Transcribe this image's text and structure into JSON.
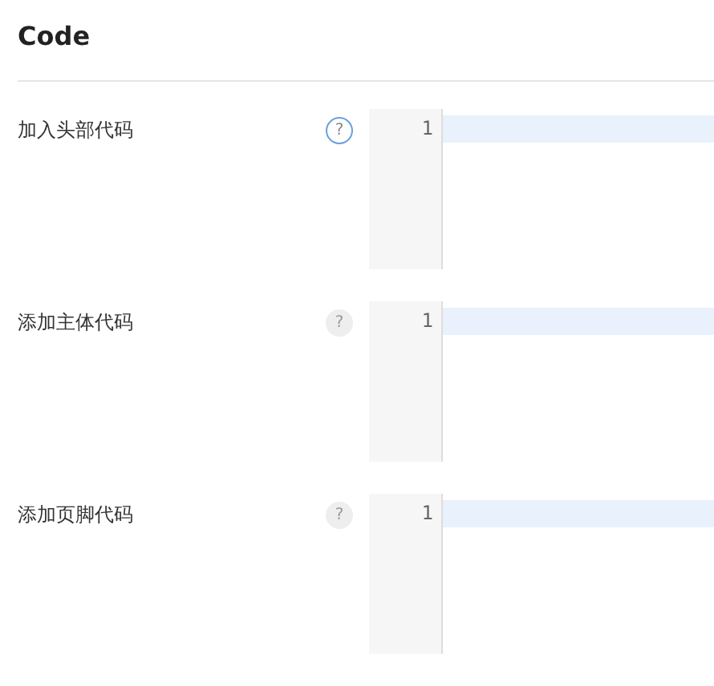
{
  "title": "Code",
  "fields": [
    {
      "label": "加入头部代码",
      "help": "?",
      "help_active": true,
      "line_number": "1"
    },
    {
      "label": "添加主体代码",
      "help": "?",
      "help_active": false,
      "line_number": "1"
    },
    {
      "label": "添加页脚代码",
      "help": "?",
      "help_active": false,
      "line_number": "1"
    }
  ]
}
